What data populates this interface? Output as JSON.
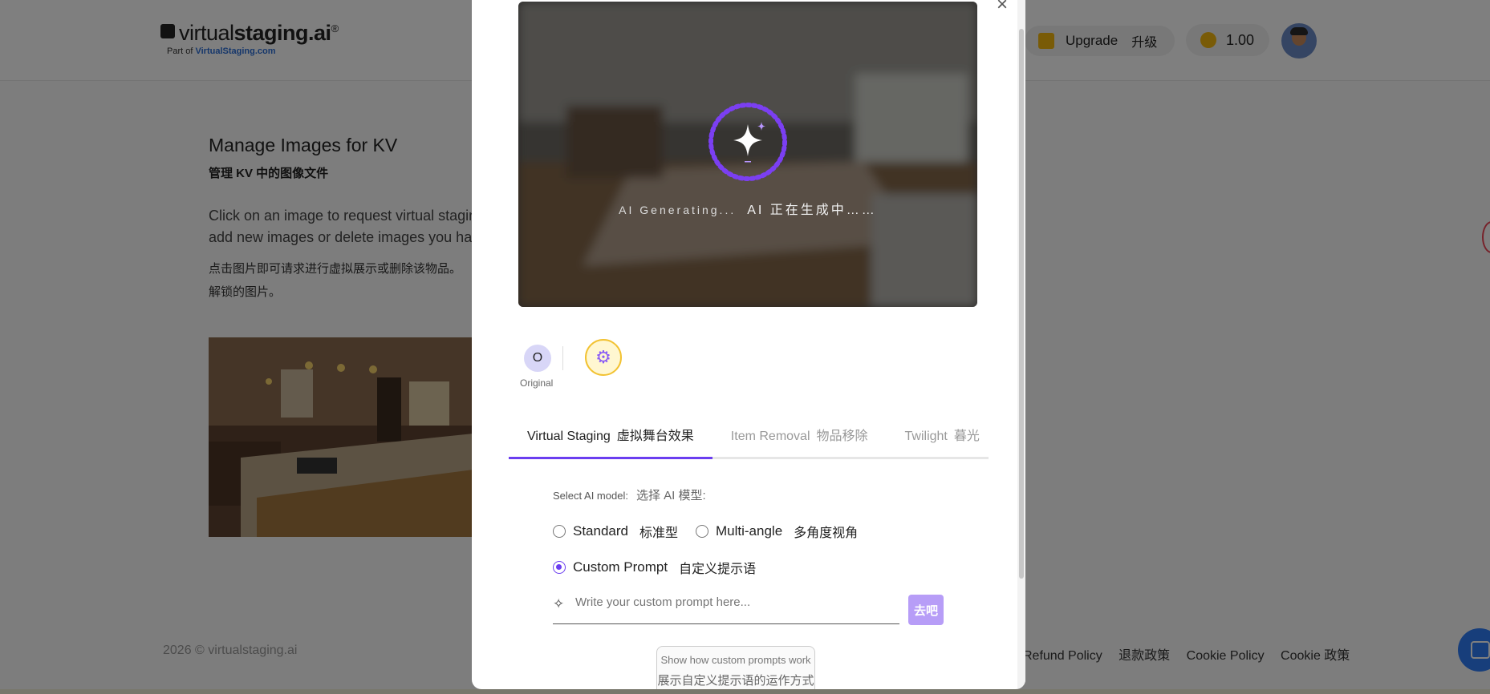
{
  "header": {
    "logo": {
      "prefix": "virtual",
      "bold": "staging.ai",
      "reg": "®",
      "sub_prefix": "Part of",
      "sub_brand": "VirtualStaging.com"
    },
    "upgrade_label": "Upgrade",
    "upgrade_label_cn": "升级",
    "credits": "1.00"
  },
  "page": {
    "title": "Manage Images for KV",
    "subtitle": "管理 KV 中的图像文件",
    "desc_en": "Click on an image to request virtual staging or\nadd new images or delete images you have",
    "desc_cn": "点击图片即可请求进行虚拟展示或删除该物品。\n解锁的图片。"
  },
  "footer": {
    "copyright": "2026 © virtualstaging.ai",
    "refund": "Refund Policy",
    "refund_cn": "退款政策",
    "cookie": "Cookie Policy",
    "cookie_cn": "Cookie 政策"
  },
  "modal": {
    "close": "×",
    "generating_en": "AI Generating...",
    "generating_cn": "AI 正在生成中……",
    "version_original_initial": "O",
    "version_original_label": "Original",
    "tabs": [
      {
        "label": "Virtual Staging",
        "label_cn": "虚拟舞台效果",
        "active": true
      },
      {
        "label": "Item Removal",
        "label_cn": "物品移除",
        "active": false
      },
      {
        "label": "Twilight",
        "label_cn": "暮光",
        "active": false
      }
    ],
    "model_label": "Select AI model:",
    "model_label_cn": "选择 AI 模型:",
    "options": [
      {
        "label": "Standard",
        "label_cn": "标准型",
        "checked": false
      },
      {
        "label": "Multi-angle",
        "label_cn": "多角度视角",
        "checked": false
      },
      {
        "label": "Custom Prompt",
        "label_cn": "自定义提示语",
        "checked": true
      }
    ],
    "prompt_placeholder": "Write your custom prompt here...",
    "go_button": "去吧",
    "help_en": "Show how custom prompts work",
    "help_cn": "展示自定义提示语的运作方式"
  },
  "colors": {
    "accent": "#6b3ef0",
    "go_button": "#b79df7",
    "coin": "#f3b70f",
    "overlay": "rgba(0,0,0,0.5)"
  }
}
